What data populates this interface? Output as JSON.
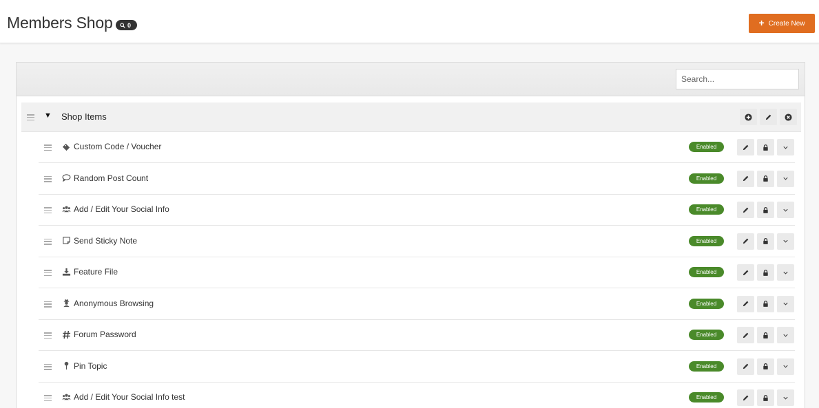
{
  "header": {
    "title": "Members Shop",
    "badge_count": "0",
    "create_label": "Create New"
  },
  "search": {
    "placeholder": "Search..."
  },
  "group": {
    "title": "Shop Items"
  },
  "items": [
    {
      "label": "Custom Code / Voucher",
      "icon": "ticket-icon",
      "status": "Enabled"
    },
    {
      "label": "Random Post Count",
      "icon": "speech-bubble-icon",
      "status": "Enabled"
    },
    {
      "label": "Add / Edit Your Social Info",
      "icon": "users-icon",
      "status": "Enabled"
    },
    {
      "label": "Send Sticky Note",
      "icon": "sticky-note-icon",
      "status": "Enabled"
    },
    {
      "label": "Feature File",
      "icon": "download-icon",
      "status": "Enabled"
    },
    {
      "label": "Anonymous Browsing",
      "icon": "user-secret-icon",
      "status": "Enabled"
    },
    {
      "label": "Forum Password",
      "icon": "hashtag-icon",
      "status": "Enabled"
    },
    {
      "label": "Pin Topic",
      "icon": "pin-icon",
      "status": "Enabled"
    },
    {
      "label": "Add / Edit Your Social Info test",
      "icon": "users-icon",
      "status": "Enabled"
    }
  ],
  "colors": {
    "accent": "#e06d20",
    "enabled": "#4a8a2a",
    "title_badge": "#333333"
  }
}
